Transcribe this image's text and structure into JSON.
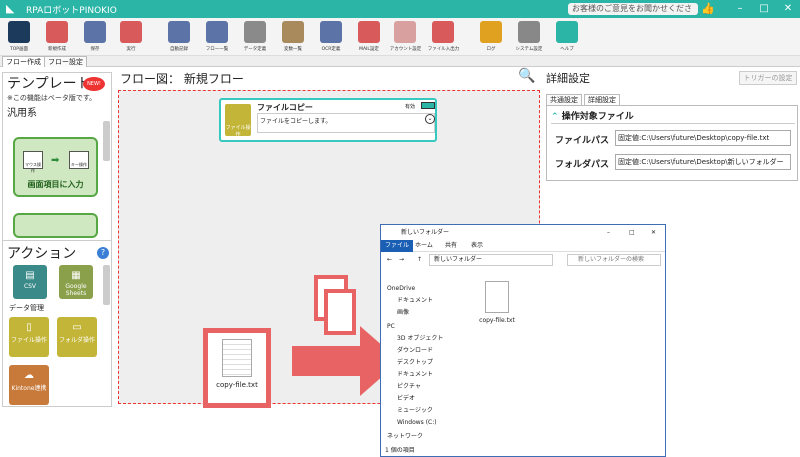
{
  "titlebar": {
    "title": "RPAロボットPINOKIO",
    "feedback": "お客様のご意見をお聞かせください",
    "minimize": "–",
    "maximize": "□",
    "close": "✕"
  },
  "toolbar": {
    "items": [
      "TOP画面",
      "新規作成",
      "保存",
      "実行",
      "自動記録",
      "フロー一覧",
      "データ定義",
      "変数一覧",
      "OCR定義",
      "MAIL設定",
      "アカウント設定",
      "ファイル入出力",
      "ログ",
      "システム設定",
      "ヘルプ"
    ],
    "colors": [
      "#1b3a5c",
      "#d95a5a",
      "#5b73a6",
      "#d95a5a",
      "#5b73a6",
      "#5b73a6",
      "#8a8a8a",
      "#a88a5c",
      "#5b73a6",
      "#d95a5a",
      "#d9a0a0",
      "#d95a5a",
      "#e0a020",
      "#888888",
      "#2bb5a6"
    ]
  },
  "tabs": {
    "flow_create": "フロー作成",
    "flow_settings": "フロー設定"
  },
  "left": {
    "template_title": "テンプレート",
    "new_badge": "NEW!",
    "beta_note": "※この機能はベータ版です。",
    "category": "汎用系",
    "template_card": "画面項目に入力",
    "mouse_label": "マウス操作",
    "key_label": "キー操作",
    "action_title": "アクション",
    "help": "?",
    "tiles_top": [
      {
        "label": "CSV",
        "color": "#3a8a8a"
      },
      {
        "label": "Google Sheets",
        "color": "#8aa04a"
      }
    ],
    "data_mgmt": "データ管理",
    "tiles_mid": [
      {
        "label": "ファイル操作",
        "color": "#c3b538"
      },
      {
        "label": "フォルダ操作",
        "color": "#c3b538"
      }
    ],
    "tiles_bot": [
      {
        "label": "Kintone連携",
        "color": "#c87a3a"
      }
    ]
  },
  "center": {
    "flow_label": "フロー図：",
    "flow_name": "新規フロー",
    "node": {
      "title": "ファイルコピー",
      "description": "ファイルをコピーします。",
      "state": "有効",
      "icon_label": "ファイル操作"
    },
    "file_label": "copy-file.txt"
  },
  "right": {
    "title": "詳細設定",
    "trigger": "トリガーの設定",
    "tab_common": "共通設定",
    "tab_detail": "詳細設定",
    "section": "操作対象ファイル",
    "file_path_label": "ファイルパス",
    "file_path_value": "固定値:C:\\Users\\future\\Desktop\\copy-file.txt",
    "folder_path_label": "フォルダパス",
    "folder_path_value": "固定値:C:\\Users\\future\\Desktop\\新しいフォルダー"
  },
  "explorer": {
    "title": "新しいフォルダー",
    "ribbon": [
      "ファイル",
      "ホーム",
      "共有",
      "表示"
    ],
    "address": "新しいフォルダー",
    "search": "新しいフォルダーの検索",
    "nav": [
      "OneDrive",
      "ドキュメント",
      "画像",
      "PC",
      "3D オブジェクト",
      "ダウンロード",
      "デスクトップ",
      "ドキュメント",
      "ピクチャ",
      "ビデオ",
      "ミュージック",
      "Windows (C:)",
      "ネットワーク"
    ],
    "file": "copy-file.txt",
    "status": "1 個の項目"
  }
}
